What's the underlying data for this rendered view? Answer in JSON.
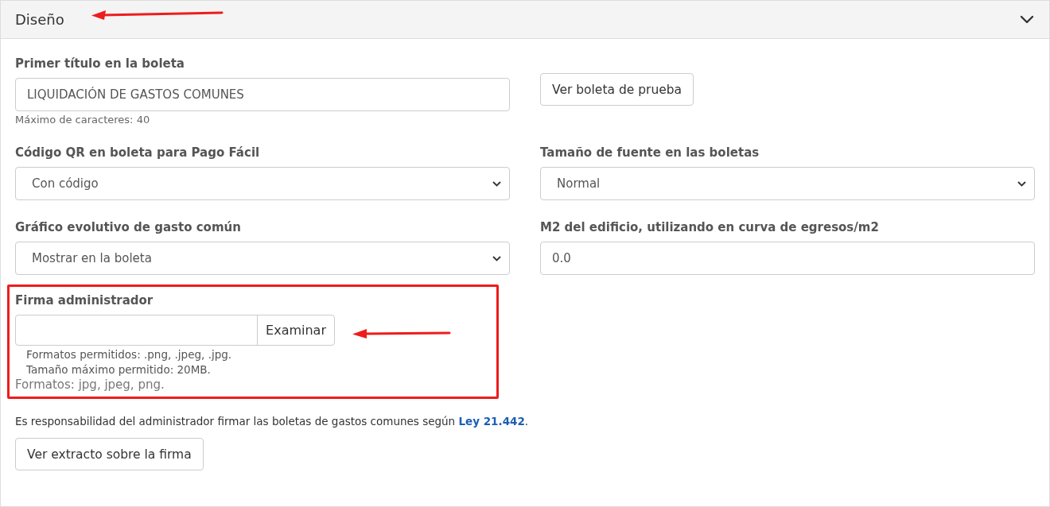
{
  "section": {
    "title": "Diseño",
    "expanded": true
  },
  "fields": [
    {
      "kind": "text",
      "label": "Primer título en la boleta",
      "value": "LIQUIDACIÓN DE GASTOS COMUNES",
      "hint": "Máximo de caracteres: 40"
    },
    {
      "kind": "button",
      "label": "Ver boleta de prueba"
    },
    {
      "kind": "select",
      "label": "Código QR en boleta para Pago Fácil",
      "value": "Con código"
    },
    {
      "kind": "select",
      "label": "Tamaño de fuente en las boletas",
      "value": "Normal"
    },
    {
      "kind": "select",
      "label": "Gráfico evolutivo de gasto común",
      "value": "Mostrar en la boleta"
    },
    {
      "kind": "text",
      "label": "M2 del edificio, utilizando en curva de egresos/m2",
      "value": "0.0"
    }
  ],
  "signature": {
    "label": "Firma administrador",
    "button": "Examinar",
    "notes": [
      "Formatos permitidos: .png, .jpeg, .jpg.",
      "Tamaño máximo permitido: 20MB."
    ],
    "help": "Formatos: jpg, jpeg, png."
  },
  "legal": {
    "text": "Es responsabilidad del administrador firmar las boletas de gastos comunes según ",
    "link": "Ley 21.442",
    "after": "."
  },
  "extract_button": "Ver extracto sobre la firma"
}
